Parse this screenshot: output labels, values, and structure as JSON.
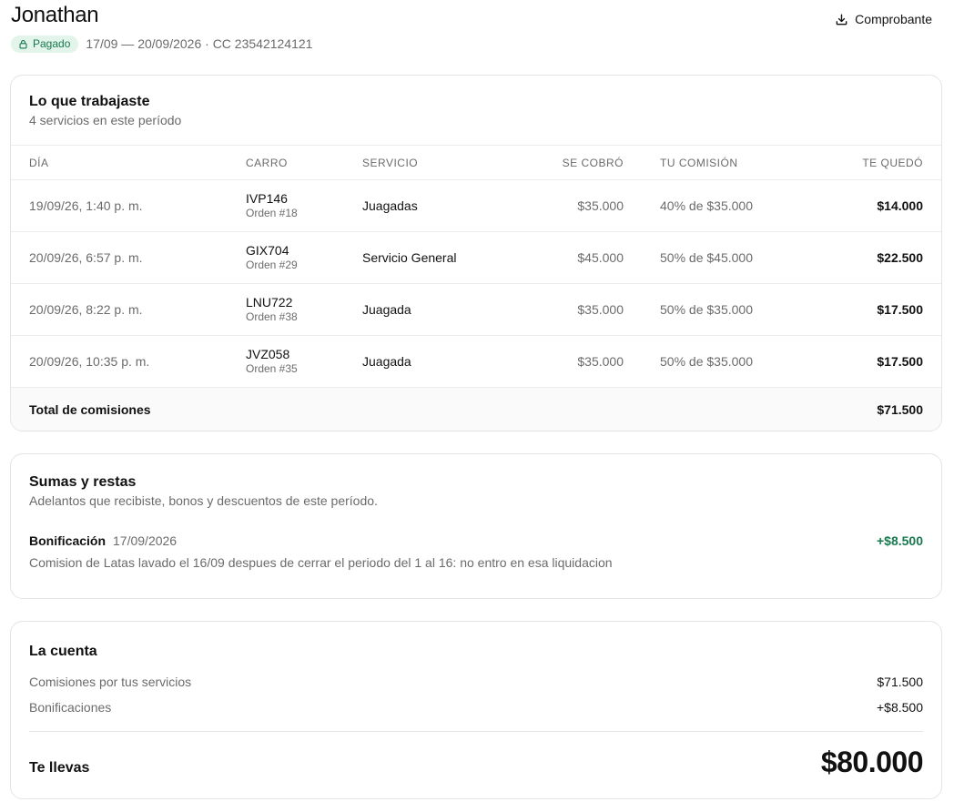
{
  "header": {
    "name": "Jonathan",
    "status_badge": "Pagado",
    "meta": "17/09 — 20/09/2026 · CC 23542124121",
    "receipt_button": "Comprobante"
  },
  "work": {
    "title": "Lo que trabajaste",
    "subtitle": "4 servicios en este período",
    "columns": {
      "day": "DÍA",
      "car": "CARRO",
      "service": "SERVICIO",
      "charged": "SE COBRÓ",
      "commission": "TU COMISIÓN",
      "kept": "TE QUEDÓ"
    },
    "rows": [
      {
        "day": "19/09/26, 1:40 p. m.",
        "plate": "IVP146",
        "order": "Orden #18",
        "service": "Juagadas",
        "charged": "$35.000",
        "commission": "40% de $35.000",
        "kept": "$14.000"
      },
      {
        "day": "20/09/26, 6:57 p. m.",
        "plate": "GIX704",
        "order": "Orden #29",
        "service": "Servicio General",
        "charged": "$45.000",
        "commission": "50% de $45.000",
        "kept": "$22.500"
      },
      {
        "day": "20/09/26, 8:22 p. m.",
        "plate": "LNU722",
        "order": "Orden #38",
        "service": "Juagada",
        "charged": "$35.000",
        "commission": "50% de $35.000",
        "kept": "$17.500"
      },
      {
        "day": "20/09/26, 10:35 p. m.",
        "plate": "JVZ058",
        "order": "Orden #35",
        "service": "Juagada",
        "charged": "$35.000",
        "commission": "50% de $35.000",
        "kept": "$17.500"
      }
    ],
    "total_label": "Total de comisiones",
    "total_value": "$71.500"
  },
  "adjustments": {
    "title": "Sumas y restas",
    "subtitle": "Adelantos que recibiste, bonos y descuentos de este período.",
    "items": [
      {
        "type": "Bonificación",
        "date": "17/09/2026",
        "amount": "+$8.500",
        "note": "Comision de Latas lavado el 16/09 despues de cerrar el periodo del 1 al 16: no entro en esa liquidacion"
      }
    ]
  },
  "account": {
    "title": "La cuenta",
    "lines": [
      {
        "label": "Comisiones por tus servicios",
        "value": "$71.500"
      },
      {
        "label": "Bonificaciones",
        "value": "+$8.500"
      }
    ],
    "final_label": "Te llevas",
    "final_value": "$80.000"
  },
  "colors": {
    "positive": "#18794e",
    "badge_bg": "#e3f4ea",
    "muted_text": "#6b6b6b",
    "border": "#e4e4e4"
  },
  "icons": {
    "badge": "lock-icon",
    "receipt": "download-icon"
  }
}
